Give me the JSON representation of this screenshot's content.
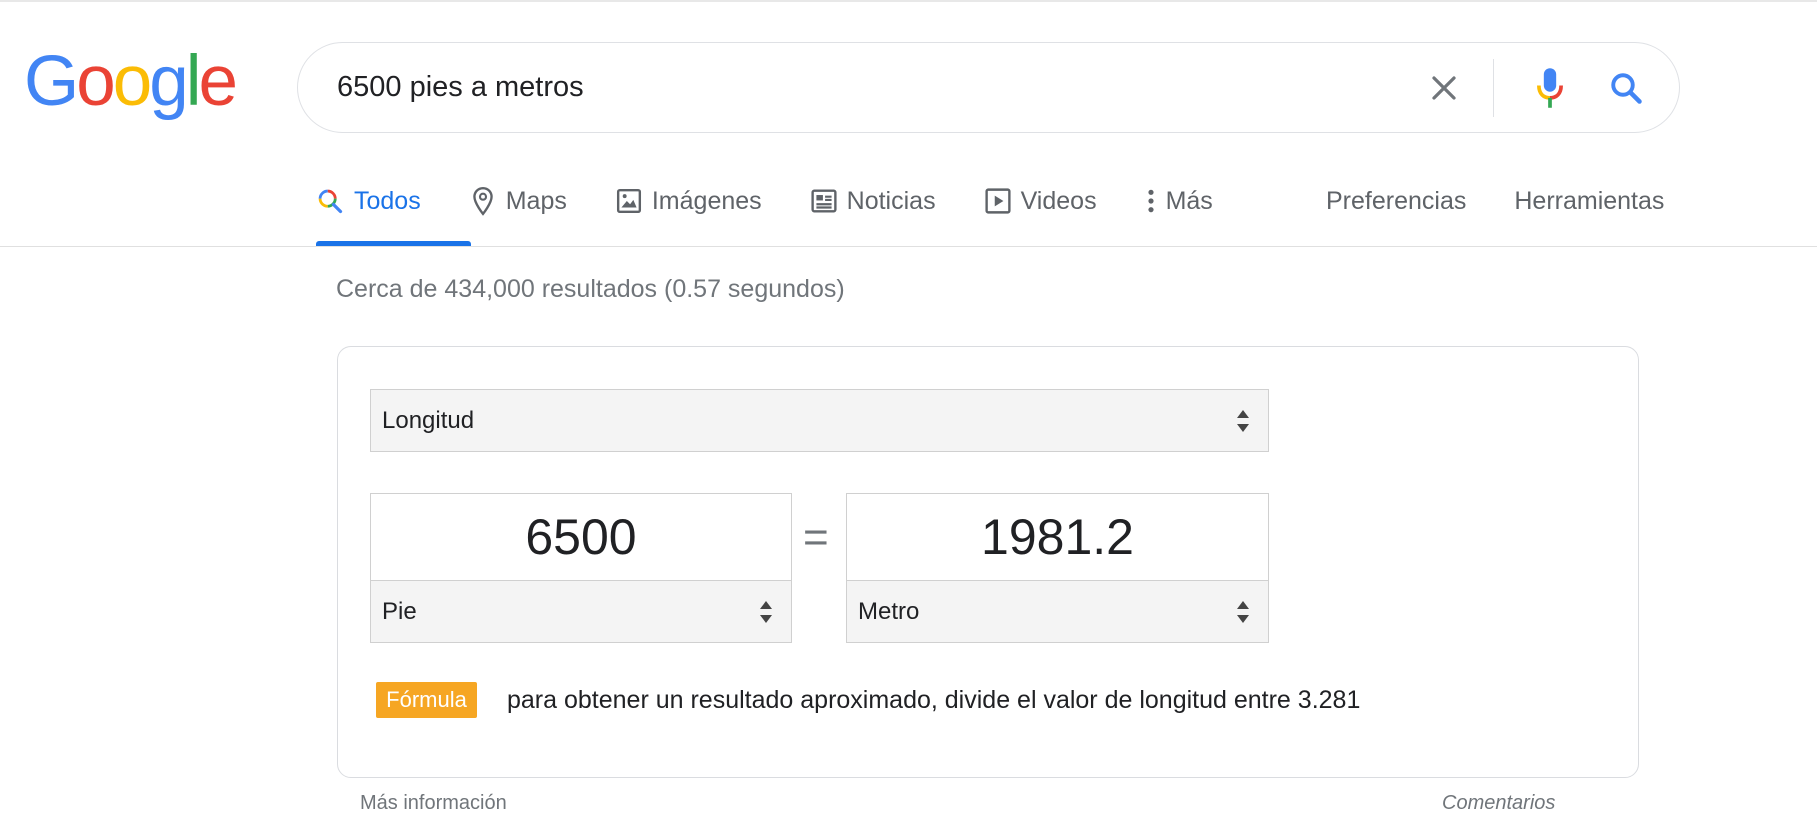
{
  "logo": {
    "letters": [
      "G",
      "o",
      "o",
      "g",
      "l",
      "e"
    ]
  },
  "search": {
    "query": "6500 pies a metros"
  },
  "tabs": [
    {
      "label": "Todos",
      "icon": "search-icon",
      "active": true
    },
    {
      "label": "Maps",
      "icon": "map-pin-icon"
    },
    {
      "label": "Imágenes",
      "icon": "image-icon"
    },
    {
      "label": "Noticias",
      "icon": "news-icon"
    },
    {
      "label": "Videos",
      "icon": "play-icon"
    },
    {
      "label": "Más",
      "icon": "more-vertical-icon"
    }
  ],
  "tools": {
    "preferences": "Preferencias",
    "tools": "Herramientas"
  },
  "result_stats": "Cerca de 434,000 resultados (0.57 segundos)",
  "converter": {
    "unit_type": "Longitud",
    "from": {
      "value": "6500",
      "unit": "Pie"
    },
    "equals": "=",
    "to": {
      "value": "1981.2",
      "unit": "Metro"
    },
    "formula_label": "Fórmula",
    "formula_text": "para obtener un resultado aproximado, divide el valor de longitud entre 3.281"
  },
  "footer": {
    "more_info": "Más información",
    "feedback": "Comentarios"
  },
  "colors": {
    "accent": "#1a73e8",
    "formula_badge": "#f6a623"
  }
}
